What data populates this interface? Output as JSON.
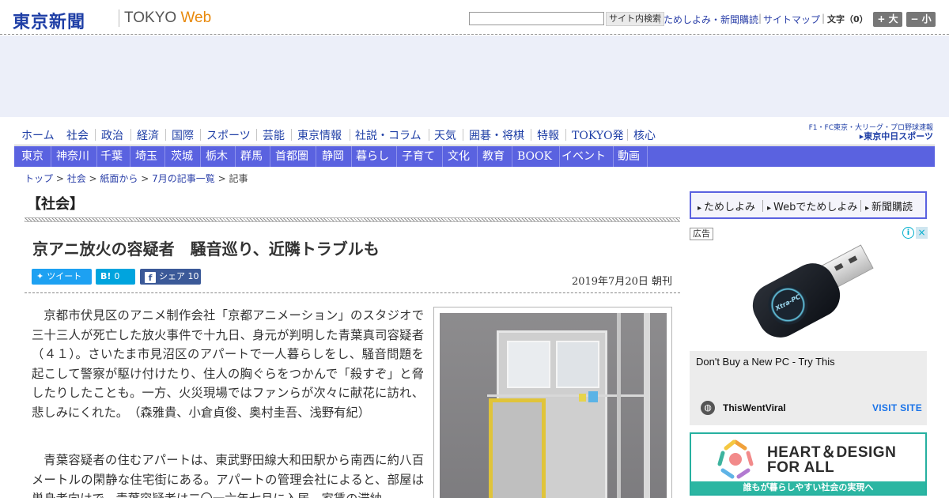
{
  "header": {
    "logo": "東京新聞",
    "logo_sub_prefix": "TOKYO",
    "logo_sub_web": "Web",
    "search_placeholder": "",
    "search_button": "サイト内検索",
    "links": [
      "ためしよみ・新聞購読",
      "サイトマップ"
    ],
    "font_size_label": "文字（0）",
    "font_larger": "+ 大",
    "font_smaller": "− 小"
  },
  "nav_main": [
    "ホーム",
    "社会",
    "政治",
    "経済",
    "国際",
    "スポーツ",
    "芸能",
    "東京情報",
    "社説・コラム",
    "天気",
    "囲碁・将棋",
    "特報",
    "TOKYO発",
    "核心"
  ],
  "chunichi": {
    "line1": "F1・FC東京・大リーグ・プロ野球速報",
    "line2": "▸東京中日スポーツ"
  },
  "nav_region": [
    "東京",
    "神奈川",
    "千葉",
    "埼玉",
    "茨城",
    "栃木",
    "群馬",
    "首都圏",
    "静岡",
    "暮らし",
    "子育て",
    "文化",
    "教育",
    "BOOK",
    "イベント",
    "動画"
  ],
  "breadcrumb": {
    "items": [
      "トップ",
      "社会",
      "紙面から",
      "7月の記事一覧"
    ],
    "current": "記事",
    "sep": " > "
  },
  "article": {
    "section": "【社会】",
    "headline": "京アニ放火の容疑者　騒音巡り、近隣トラブルも",
    "share": {
      "tweet": "ツイート",
      "hatena_icon": "B!",
      "hatena_count": "0",
      "fb_icon": "f",
      "fb_label": "シェア",
      "fb_count": "10"
    },
    "date": "2019年7月20日 朝刊",
    "paragraph1": "京都市伏見区のアニメ制作会社「京都アニメーション」のスタジオで三十三人が死亡した放火事件で十九日、身元が判明した青葉真司容疑者（４１）。さいたま市見沼区のアパートで一人暮らしをし、騒音問題を起こして警察が駆け付けたり、住人の胸ぐらをつかんで「殺すぞ」と脅したりしたことも。一方、火災現場ではファンらが次々に献花に訪れ、悲しみにくれた。　（森雅貴、小倉貞俊、奥村圭吾、浅野有紀）",
    "paragraph2": "青葉容疑者の住むアパートは、東武野田線大和田駅から南西に約八百メートルの閑静な住宅街にある。アパートの管理会社によると、部屋は単身者向けで、青葉容疑者は二〇一六年七月に入居。家賃の滞納"
  },
  "sidebar": {
    "promo": [
      "ためしよみ",
      "Webでためしよみ",
      "新聞購読"
    ],
    "ad_label": "広告",
    "ad_info_icon": "i",
    "ad_close_icon": "×",
    "usb_brand": "Xtra-PC",
    "native_ad": {
      "title": "Don't Buy a New PC - Try This",
      "brand": "ThisWentViral",
      "cta": "VISIT SITE"
    },
    "heart_ad": {
      "line1": "HEART＆DESIGN",
      "line2": "FOR ALL",
      "bar": "誰もが暮らしやすい社会の実現へ"
    }
  },
  "colors": {
    "brand_blue": "#1f3fa6",
    "nav_bar": "#5a62e0",
    "web_orange": "#e8890c",
    "twitter": "#1da1f2",
    "hatena": "#00a4de",
    "facebook": "#3b5998"
  }
}
